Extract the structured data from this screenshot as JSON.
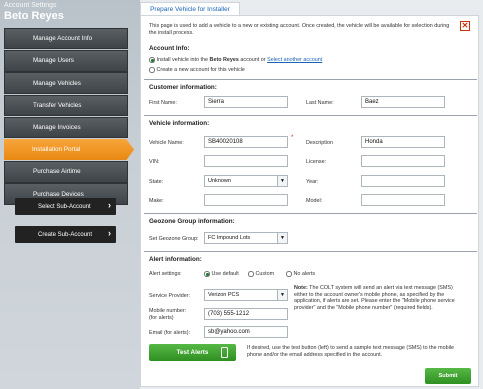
{
  "sidebar": {
    "header_small": "Account Settings",
    "header_name": "Beto Reyes",
    "menu": [
      {
        "label": "Manage Account Info"
      },
      {
        "label": "Manage Users"
      },
      {
        "label": "Manage Vehicles"
      },
      {
        "label": "Transfer Vehicles"
      },
      {
        "label": "Manage Invoices"
      },
      {
        "label": "Installation Portal"
      },
      {
        "label": "Purchase Airtime"
      },
      {
        "label": "Purchase Devices"
      }
    ],
    "select_sub_account": "Select Sub-Account",
    "create_sub_account": "Create Sub-Account"
  },
  "tab": {
    "label": "Prepare Vehicle for Installer"
  },
  "intro": "This page is used to add a vehicle to a new or existing account. Once created, the vehicle will be available for selection during the install process.",
  "account": {
    "title": "Account Info:",
    "opt1_pre": "Install vehicle into the ",
    "opt1_name": "Beto Reyes",
    "opt1_post": " account  or  ",
    "opt1_link": "Select another account",
    "opt2": "Create a new account for this vehicle"
  },
  "customer": {
    "title": "Customer information:",
    "first_label": "First Name:",
    "first_value": "Sierra",
    "last_label": "Last Name:",
    "last_value": "Baez"
  },
  "vehicle": {
    "title": "Vehicle information:",
    "name_label": "Vehicle Name:",
    "name_value": "SB40020108",
    "required": "*",
    "desc_label": "Description",
    "desc_value": "Honda",
    "vin_label": "VIN:",
    "vin_value": "",
    "license_label": "License:",
    "license_value": "",
    "state_label": "State:",
    "state_value": "Unknown",
    "year_label": "Year:",
    "year_value": "",
    "make_label": "Make:",
    "make_value": "",
    "model_label": "Model:",
    "model_value": ""
  },
  "geozone": {
    "title": "Geozone Group information:",
    "label": "Set Geozone Group:",
    "value": "FC Impound Lots"
  },
  "alerts": {
    "title": "Alert information:",
    "settings_label": "Alert settings:",
    "opt_default": "Use default",
    "opt_custom": "Custom",
    "opt_none": "No alerts",
    "provider_label": "Service Provider:",
    "provider_value": "Verizon PCS",
    "mobile_label": "Mobile number:",
    "mobile_sub": "(for alerts)",
    "mobile_value": "(703) 555-1212",
    "email_label": "Email (for alerts):",
    "email_value": "sb@yahoo.com",
    "note_bold": "Note:",
    "note_text": " The COLT system will send an alert via text message (SMS) either to the account owner's mobile phone, as specified by the application, if alerts are set. Please enter the \"Mobile phone service provider\" and the \"Mobile phone number\" (required fields).",
    "test_button": "Test Alerts",
    "test_text": "If desired, use the test button (left) to send a sample text message (SMS) to the mobile phone and/or the email address specified in the account."
  },
  "submit": "Submit"
}
